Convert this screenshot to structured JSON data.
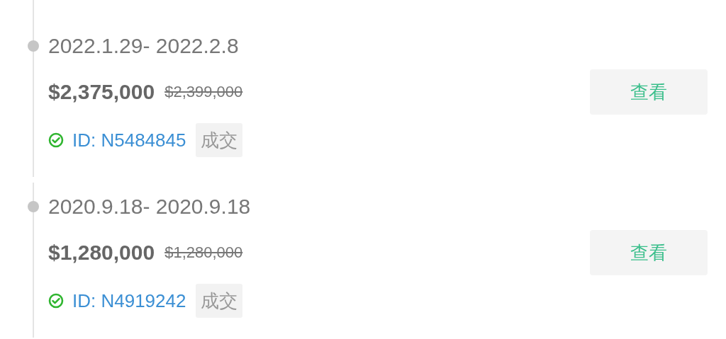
{
  "records": [
    {
      "date": "2022.1.29- 2022.2.8",
      "price": "$2,375,000",
      "original_price": "$2,399,000",
      "verified": true,
      "listing_id": "ID: N5484845",
      "status": "成交",
      "button": "查看"
    },
    {
      "date": "2020.9.18- 2020.9.18",
      "price": "$1,280,000",
      "original_price": "$1,280,000",
      "verified": true,
      "listing_id": "ID: N4919242",
      "status": "成交",
      "button": "查看"
    }
  ]
}
